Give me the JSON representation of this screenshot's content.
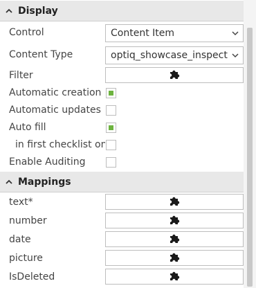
{
  "display": {
    "title": "Display",
    "control": {
      "label": "Control",
      "value": "Content Item"
    },
    "content_type": {
      "label": "Content Type",
      "value": "optiq_showcase_inspecte"
    },
    "filter": {
      "label": "Filter",
      "icon": "puzzle-icon"
    },
    "automatic_creation": {
      "label": "Automatic creation",
      "checked": true
    },
    "automatic_updates": {
      "label": "Automatic updates",
      "checked": false
    },
    "auto_fill": {
      "label": "Auto fill",
      "checked": true
    },
    "first_checklist_only": {
      "label": "in first checklist only",
      "checked": false
    },
    "enable_auditing": {
      "label": "Enable Auditing",
      "checked": false
    }
  },
  "mappings": {
    "title": "Mappings",
    "items": [
      {
        "label": "text*",
        "icon": "puzzle-icon"
      },
      {
        "label": "number",
        "icon": "puzzle-icon"
      },
      {
        "label": "date",
        "icon": "puzzle-icon"
      },
      {
        "label": "picture",
        "icon": "puzzle-icon"
      },
      {
        "label": "IsDeleted",
        "icon": "puzzle-icon"
      }
    ]
  },
  "colors": {
    "header_bg": "#e8e8e8",
    "checkbox_checked": "#6db33f",
    "border": "#bdbdbd",
    "text": "#444444"
  }
}
